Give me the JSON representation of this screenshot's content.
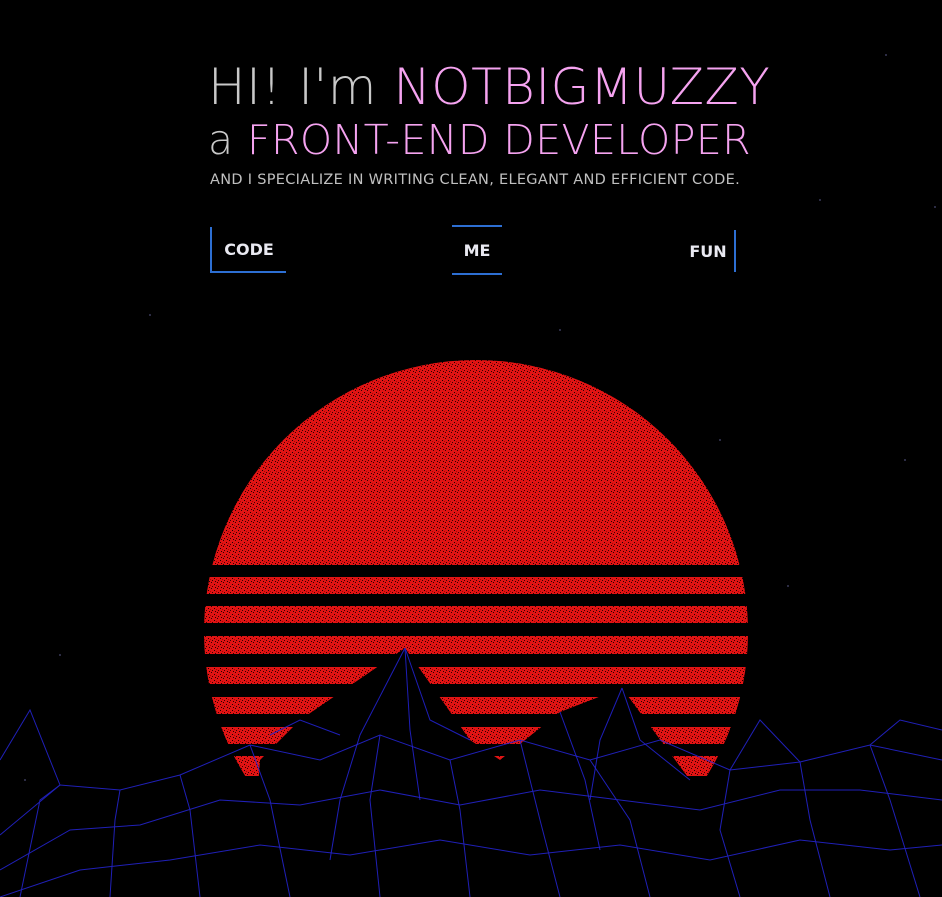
{
  "hero": {
    "greeting": "HI! I'm ",
    "name": "NOTBIGMUZZY",
    "role_prefix": "a ",
    "role": "FRONT-END DEVELOPER",
    "tagline": "AND I SPECIALIZE IN WRITING CLEAN, ELEGANT AND EFFICIENT CODE."
  },
  "nav": {
    "code": "CODE",
    "me": "ME",
    "fun": "FUN"
  },
  "colors": {
    "background": "#000000",
    "highlight": "#f5a3f0",
    "accent_border": "#2d6fd3",
    "sun": "#e01212",
    "wireframe": "#2a2ad8"
  }
}
